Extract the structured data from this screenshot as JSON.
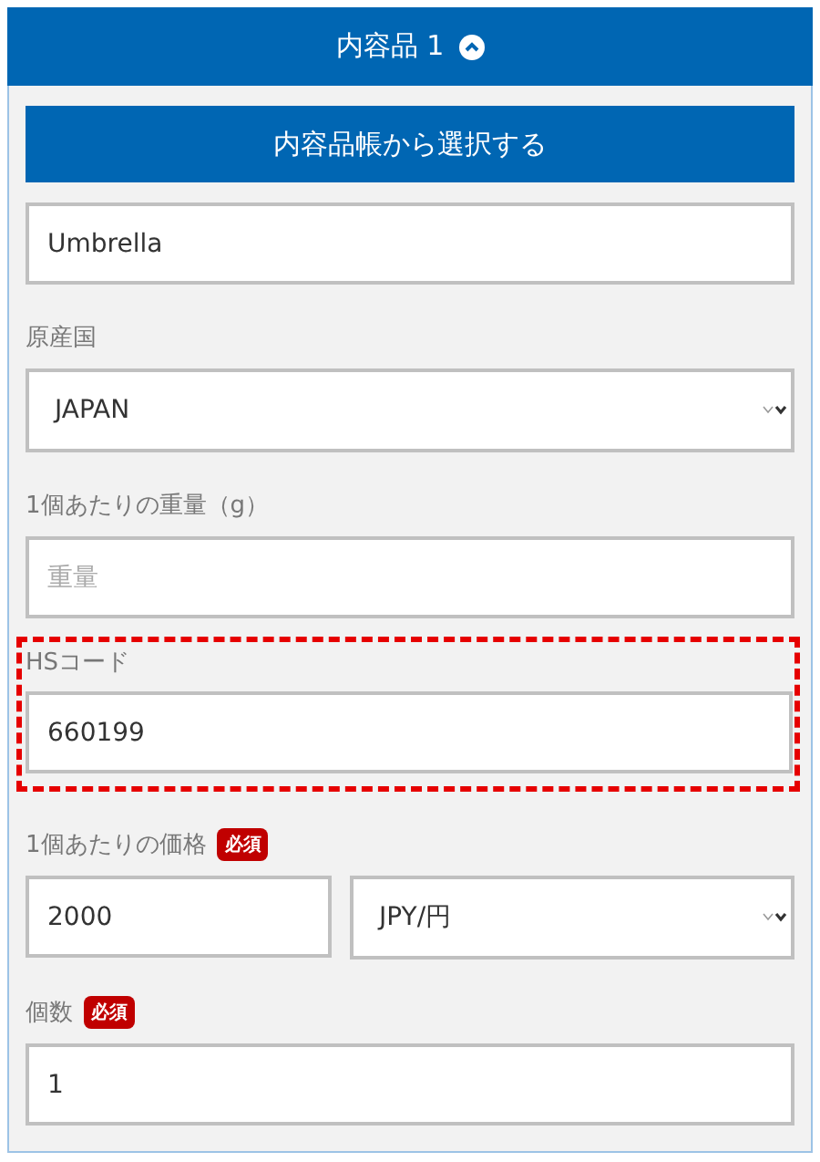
{
  "panel": {
    "title": "内容品 1",
    "expanded": true
  },
  "select_button": {
    "label": "内容品帳から選択する"
  },
  "fields": [
    {
      "kind": "input",
      "value": "Umbrella"
    },
    {
      "kind": "select",
      "label": "原産国",
      "value": "JAPAN"
    },
    {
      "kind": "input",
      "label": "1個あたりの重量（g）",
      "placeholder": "重量"
    },
    {
      "kind": "input",
      "label": "HSコード",
      "value": "660199",
      "highlighted": true
    },
    {
      "kind": "pair",
      "label": "1個あたりの価格",
      "badge": "必須",
      "value": "2000",
      "unit": "JPY/円",
      "required": true
    },
    {
      "kind": "input",
      "label": "個数",
      "badge": "必須",
      "value": "1",
      "required": true
    }
  ]
}
